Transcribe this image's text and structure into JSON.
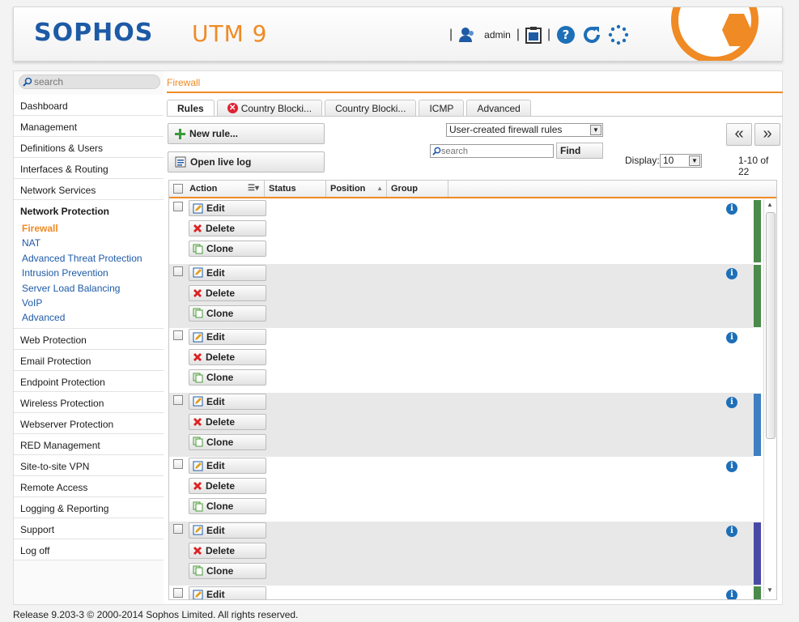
{
  "header": {
    "logo": "SOPHOS",
    "product": "UTM 9",
    "user": "admin",
    "icons": [
      "user-icon",
      "clipboard-icon",
      "help-icon",
      "refresh-icon",
      "activity-icon"
    ]
  },
  "sidebar": {
    "search_placeholder": "search",
    "items": [
      {
        "label": "Dashboard"
      },
      {
        "label": "Management"
      },
      {
        "label": "Definitions & Users"
      },
      {
        "label": "Interfaces & Routing"
      },
      {
        "label": "Network Services"
      },
      {
        "label": "Network Protection",
        "active": true
      }
    ],
    "subitems": [
      {
        "label": "Firewall",
        "current": true
      },
      {
        "label": "NAT"
      },
      {
        "label": "Advanced Threat Protection"
      },
      {
        "label": "Intrusion Prevention"
      },
      {
        "label": "Server Load Balancing"
      },
      {
        "label": "VoIP"
      },
      {
        "label": "Advanced"
      }
    ],
    "items_after": [
      {
        "label": "Web Protection"
      },
      {
        "label": "Email Protection"
      },
      {
        "label": "Endpoint Protection"
      },
      {
        "label": "Wireless Protection"
      },
      {
        "label": "Webserver Protection"
      },
      {
        "label": "RED Management"
      },
      {
        "label": "Site-to-site VPN"
      },
      {
        "label": "Remote Access"
      },
      {
        "label": "Logging & Reporting"
      },
      {
        "label": "Support"
      },
      {
        "label": "Log off"
      }
    ]
  },
  "page": {
    "title": "Firewall",
    "tabs": [
      {
        "label": "Rules",
        "active": true
      },
      {
        "label": "Country Blocki...",
        "error": true
      },
      {
        "label": "Country Blocki..."
      },
      {
        "label": "ICMP"
      },
      {
        "label": "Advanced"
      }
    ],
    "new_rule": "New rule...",
    "open_live_log": "Open live log",
    "filter_select": "User-created firewall rules",
    "search_placeholder": "search",
    "find": "Find",
    "prev": "«",
    "next": "»",
    "display_label": "Display:",
    "display_value": "10",
    "count": "1-10 of 22",
    "columns": [
      "Action",
      "Status",
      "Position",
      "Group"
    ],
    "row_buttons": {
      "edit": "Edit",
      "delete": "Delete",
      "clone": "Clone"
    },
    "info_glyph": "i",
    "rows": [
      {
        "stripe": "#4a8a4a"
      },
      {
        "stripe": "#4a8a4a"
      },
      {
        "stripe": ""
      },
      {
        "stripe": "#3d7fc1"
      },
      {
        "stripe": ""
      },
      {
        "stripe": "#4a4aa6"
      },
      {
        "stripe": "#4a8a4a"
      }
    ],
    "accent": "#f08a24",
    "brand": "#1d5aa6"
  },
  "footer": {
    "text": "Release 9.203-3  © 2000-2014 Sophos Limited. All rights reserved."
  }
}
